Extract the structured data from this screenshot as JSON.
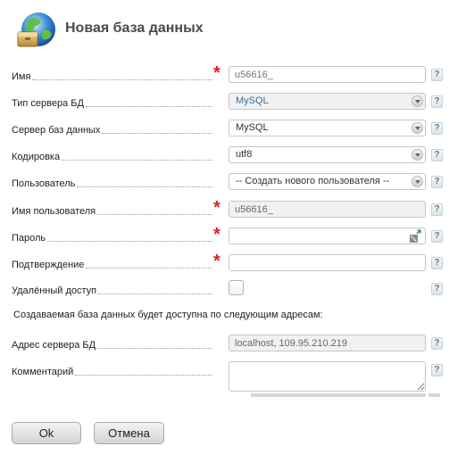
{
  "header": {
    "title": "Новая база данных",
    "icon": "database-globe-icon"
  },
  "fields": {
    "name": {
      "label": "Имя",
      "value": "u56616_",
      "required": true
    },
    "server_type": {
      "label": "Тип сервера БД",
      "value": "MySQL"
    },
    "db_server": {
      "label": "Сервер баз данных",
      "value": "MySQL"
    },
    "encoding": {
      "label": "Кодировка",
      "value": "utf8"
    },
    "user": {
      "label": "Пользователь",
      "value": "-- Создать нового пользователя --"
    },
    "username": {
      "label": "Имя пользователя",
      "value": "u56616_",
      "required": true
    },
    "password": {
      "label": "Пароль",
      "value": "",
      "required": true
    },
    "confirm": {
      "label": "Подтверждение",
      "value": "",
      "required": true
    },
    "remote_access": {
      "label": "Удалённый доступ",
      "checked": false
    },
    "note": "Создаваемая база данных будет доступна по следующим адресам:",
    "server_address": {
      "label": "Адрес сервера БД",
      "value": "localhost, 109.95.210.219"
    },
    "comment": {
      "label": "Комментарий",
      "value": ""
    }
  },
  "help_label": "?",
  "required_mark": "*",
  "buttons": {
    "ok": "Ok",
    "cancel": "Отмена"
  },
  "colors": {
    "required": "#e02020",
    "title": "#4a4a4a",
    "select_blue": "#3a6ea5"
  }
}
